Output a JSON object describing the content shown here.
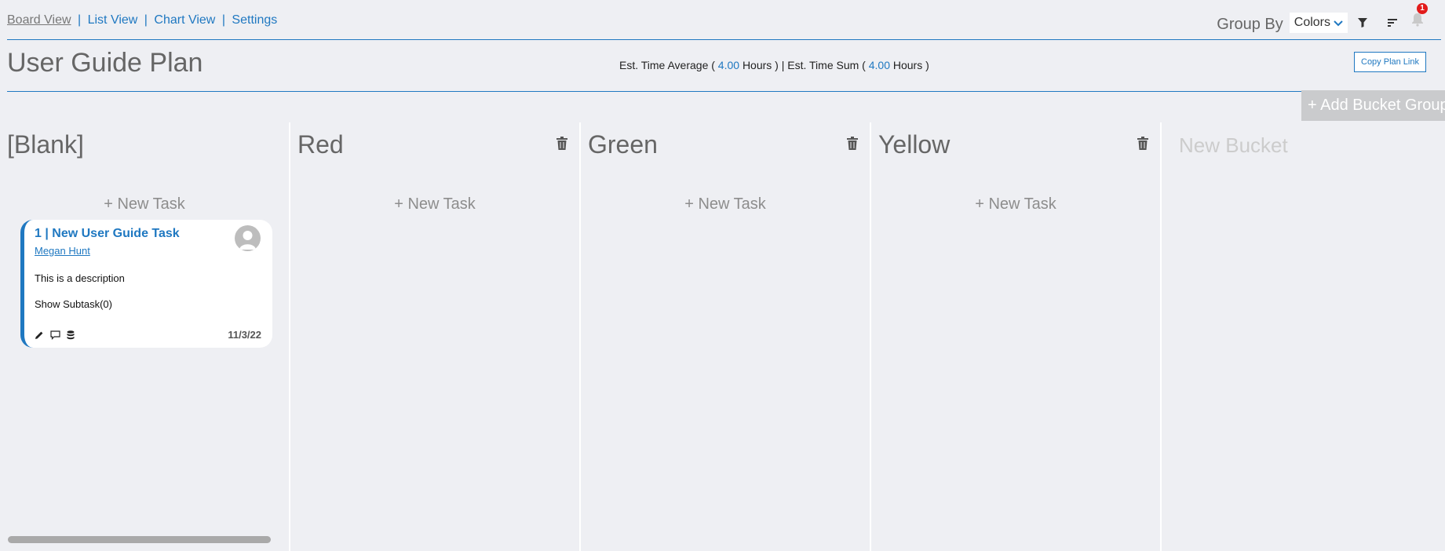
{
  "nav": {
    "board_view": "Board View",
    "list_view": "List View",
    "chart_view": "Chart View",
    "settings": "Settings",
    "separator": "|"
  },
  "toolbar": {
    "group_by_label": "Group By",
    "group_by_value": "Colors",
    "notification_count": "1"
  },
  "plan": {
    "title": "User Guide Plan",
    "est_avg_label": "Est. Time Average (",
    "est_avg_value": "4.00",
    "est_avg_unit": "Hours )",
    "est_sum_label": "Est. Time Sum (",
    "est_sum_value": "4.00",
    "est_sum_unit": "Hours )",
    "est_separator": "|",
    "copy_link_label": "Copy Plan Link"
  },
  "add_bucket_group_label": "+ Add Bucket Group",
  "new_task_label": "+ New Task",
  "buckets": [
    {
      "title": "[Blank]"
    },
    {
      "title": "Red"
    },
    {
      "title": "Green"
    },
    {
      "title": "Yellow"
    }
  ],
  "new_bucket_placeholder": "New Bucket",
  "task": {
    "title": "1 | New User Guide Task",
    "assignee": "Megan Hunt",
    "description": "This is a description",
    "subtask_label": "Show Subtask(0)",
    "date": "11/3/22",
    "accent_color": "#1f78c1"
  },
  "icons": [
    "filter-icon",
    "sort-icon",
    "bell-icon",
    "trash-icon",
    "pencil-icon",
    "comment-icon",
    "database-icon",
    "avatar-icon"
  ],
  "colors": {
    "accent": "#1f78c1",
    "badge": "#e21b1b",
    "background": "#eeeff3"
  }
}
